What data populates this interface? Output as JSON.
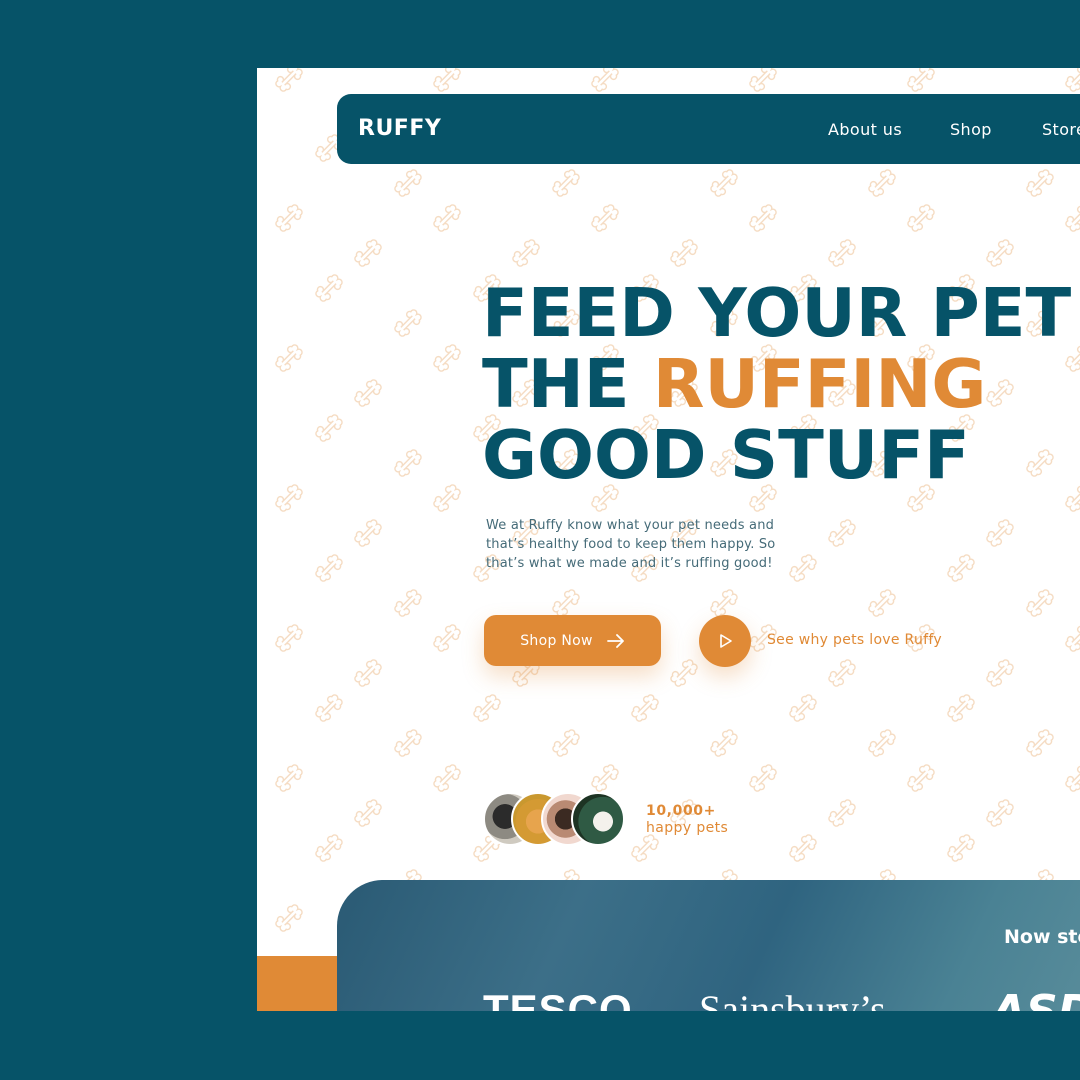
{
  "brand": {
    "name": "RUFFY"
  },
  "nav": {
    "items": [
      {
        "label": "About us"
      },
      {
        "label": "Shop"
      },
      {
        "label": "Store"
      }
    ]
  },
  "hero": {
    "headline_line1": "FEED YOUR PET",
    "headline_line2_a": "THE ",
    "headline_line2_b": "RUFFING",
    "headline_line3": "GOOD STUFF",
    "description": "We at Ruffy know what your pet needs and that’s healthy food to keep them happy. So that’s what we made and it’s ruffing good!",
    "shop_button": "Shop Now",
    "video_link": "See why pets love Ruffy"
  },
  "social_proof": {
    "count": "10,000+",
    "label": "happy pets",
    "avatars": [
      "dog-avatar-1",
      "cat-avatar",
      "dog-avatar-2",
      "puppy-avatar"
    ]
  },
  "stores": {
    "title": "Now stocked in",
    "logos": [
      "TESCO",
      "Sainsbury’s",
      "ASDA"
    ]
  },
  "colors": {
    "primary": "#065368",
    "accent": "#e08a36",
    "background": "#ffffff"
  },
  "icons": {
    "shop_button": "arrow-right-icon",
    "video": "play-icon",
    "background_pattern": "bone-icon"
  }
}
